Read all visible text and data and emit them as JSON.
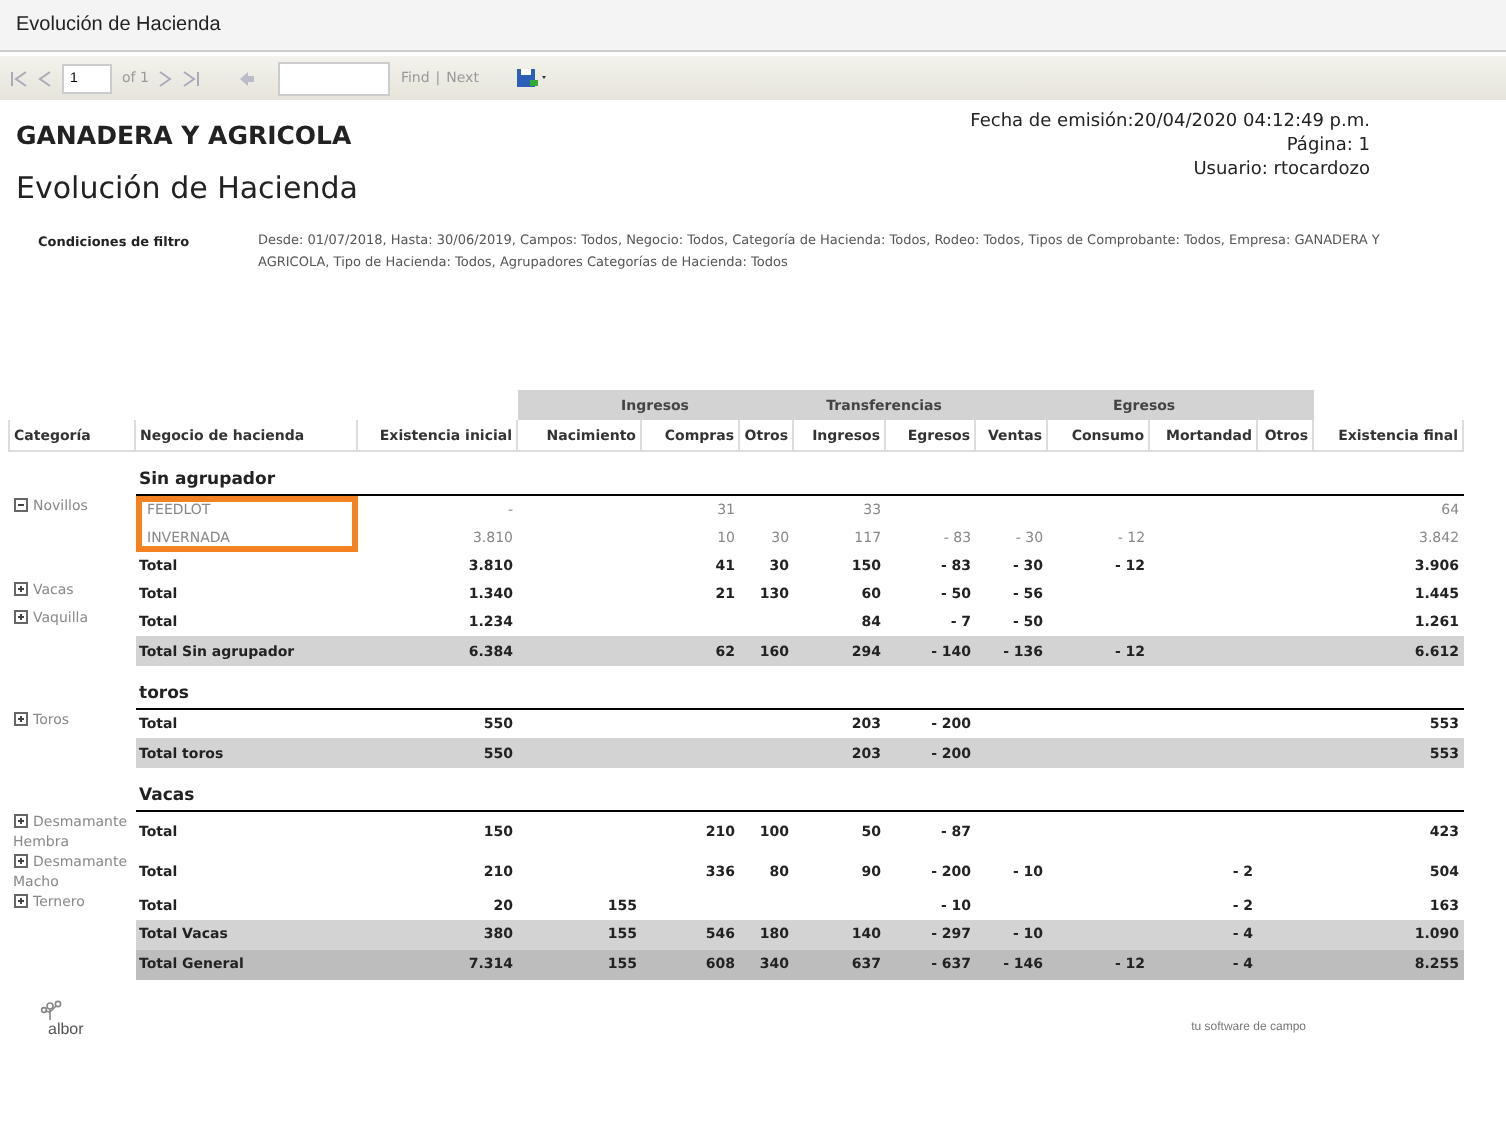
{
  "window": {
    "title": "Evolución de Hacienda"
  },
  "toolbar": {
    "page": "1",
    "page_count": "of 1",
    "find": "Find",
    "separator": "|",
    "next": "Next"
  },
  "report": {
    "company": "GANADERA Y AGRICOLA",
    "title": "Evolución de Hacienda",
    "meta": [
      "Fecha de emisión:20/04/2020 04:12:49 p.m.",
      "Página: 1",
      "Usuario: rtocardozo"
    ],
    "filter_label": "Condiciones de filtro",
    "filter_text": "Desde: 01/07/2018, Hasta: 30/06/2019, Campos: Todos, Negocio: Todos, Categoría de Hacienda: Todos, Rodeo: Todos, Tipos de Comprobante: Todos, Empresa: GANADERA Y AGRICOLA, Tipo de Hacienda: Todos, Agrupadores Categorías de Hacienda: Todos"
  },
  "table": {
    "columns": [
      {
        "label": "Categoría"
      },
      {
        "label": "Negocio de hacienda"
      },
      {
        "label": "Existencia inicial"
      },
      {
        "group": "Ingresos",
        "columns": [
          {
            "label": "Nacimiento"
          },
          {
            "label": "Compras"
          },
          {
            "label": "Otros"
          }
        ]
      },
      {
        "group": "Transferencias",
        "columns": [
          {
            "label": "Ingresos"
          },
          {
            "label": "Egresos"
          }
        ]
      },
      {
        "group": "Egresos",
        "columns": [
          {
            "label": "Ventas"
          },
          {
            "label": "Consumo"
          },
          {
            "label": "Mortandad"
          },
          {
            "label": "Otros"
          }
        ]
      },
      {
        "label": "Existencia final"
      }
    ],
    "rows": [
      {
        "kind": "group",
        "label": "Sin agrupador"
      },
      {
        "kind": "detail",
        "category": "Novillos",
        "expanded": true,
        "business": "FEEDLOT",
        "highlighted": true,
        "values": {
          "existencia_inicial": "-",
          "compras": "31",
          "transferencias_ingresos": "33",
          "existencia_final": "64"
        }
      },
      {
        "kind": "detail",
        "business": "INVERNADA",
        "highlighted": true,
        "values": {
          "existencia_inicial": "3.810",
          "compras": "10",
          "otros_ingresos": "30",
          "transferencias_ingresos": "117",
          "transferencias_egresos": "- 83",
          "ventas": "- 30",
          "consumo": "- 12",
          "existencia_final": "3.842"
        }
      },
      {
        "kind": "total",
        "business": "Total",
        "values": {
          "existencia_inicial": "3.810",
          "compras": "41",
          "otros_ingresos": "30",
          "transferencias_ingresos": "150",
          "transferencias_egresos": "- 83",
          "ventas": "- 30",
          "consumo": "- 12",
          "existencia_final": "3.906"
        }
      },
      {
        "kind": "total",
        "category": "Vacas",
        "expanded": false,
        "business": "Total",
        "values": {
          "existencia_inicial": "1.340",
          "compras": "21",
          "otros_ingresos": "130",
          "transferencias_ingresos": "60",
          "transferencias_egresos": "- 50",
          "ventas": "- 56",
          "existencia_final": "1.445"
        }
      },
      {
        "kind": "total",
        "category": "Vaquilla",
        "expanded": false,
        "business": "Total",
        "values": {
          "existencia_inicial": "1.234",
          "transferencias_ingresos": "84",
          "transferencias_egresos": "- 7",
          "ventas": "- 50",
          "existencia_final": "1.261"
        }
      },
      {
        "kind": "subtotal",
        "business": "Total Sin agrupador",
        "values": {
          "existencia_inicial": "6.384",
          "compras": "62",
          "otros_ingresos": "160",
          "transferencias_ingresos": "294",
          "transferencias_egresos": "- 140",
          "ventas": "- 136",
          "consumo": "- 12",
          "existencia_final": "6.612"
        }
      },
      {
        "kind": "group",
        "label": "toros"
      },
      {
        "kind": "total",
        "category": "Toros",
        "expanded": false,
        "business": "Total",
        "values": {
          "existencia_inicial": "550",
          "transferencias_ingresos": "203",
          "transferencias_egresos": "- 200",
          "existencia_final": "553"
        }
      },
      {
        "kind": "subtotal",
        "business": "Total  toros",
        "values": {
          "existencia_inicial": "550",
          "transferencias_ingresos": "203",
          "transferencias_egresos": "- 200",
          "existencia_final": "553"
        }
      },
      {
        "kind": "group",
        "label": "Vacas"
      },
      {
        "kind": "total",
        "category": "Desmamante Hembra",
        "expanded": false,
        "business": "Total",
        "values": {
          "existencia_inicial": "150",
          "compras": "210",
          "otros_ingresos": "100",
          "transferencias_ingresos": "50",
          "transferencias_egresos": "- 87",
          "existencia_final": "423"
        }
      },
      {
        "kind": "total",
        "category": "Desmamante Macho",
        "expanded": false,
        "business": "Total",
        "values": {
          "existencia_inicial": "210",
          "compras": "336",
          "otros_ingresos": "80",
          "transferencias_ingresos": "90",
          "transferencias_egresos": "- 200",
          "ventas": "- 10",
          "mortandad": "- 2",
          "existencia_final": "504"
        }
      },
      {
        "kind": "total",
        "category": "Ternero",
        "expanded": false,
        "business": "Total",
        "values": {
          "existencia_inicial": "20",
          "nacimiento": "155",
          "transferencias_egresos": "- 10",
          "mortandad": "- 2",
          "existencia_final": "163"
        }
      },
      {
        "kind": "subtotal",
        "business": "Total Vacas",
        "values": {
          "existencia_inicial": "380",
          "nacimiento": "155",
          "compras": "546",
          "otros_ingresos": "180",
          "transferencias_ingresos": "140",
          "transferencias_egresos": "- 297",
          "ventas": "- 10",
          "mortandad": "- 4",
          "existencia_final": "1.090"
        }
      },
      {
        "kind": "grand",
        "business": "Total General",
        "values": {
          "existencia_inicial": "7.314",
          "nacimiento": "155",
          "compras": "608",
          "otros_ingresos": "340",
          "transferencias_ingresos": "637",
          "transferencias_egresos": "- 637",
          "ventas": "- 146",
          "consumo": "- 12",
          "mortandad": "- 4",
          "existencia_final": "8.255"
        }
      }
    ]
  },
  "footer": {
    "logo": "albor",
    "tagline": "tu software de campo"
  }
}
